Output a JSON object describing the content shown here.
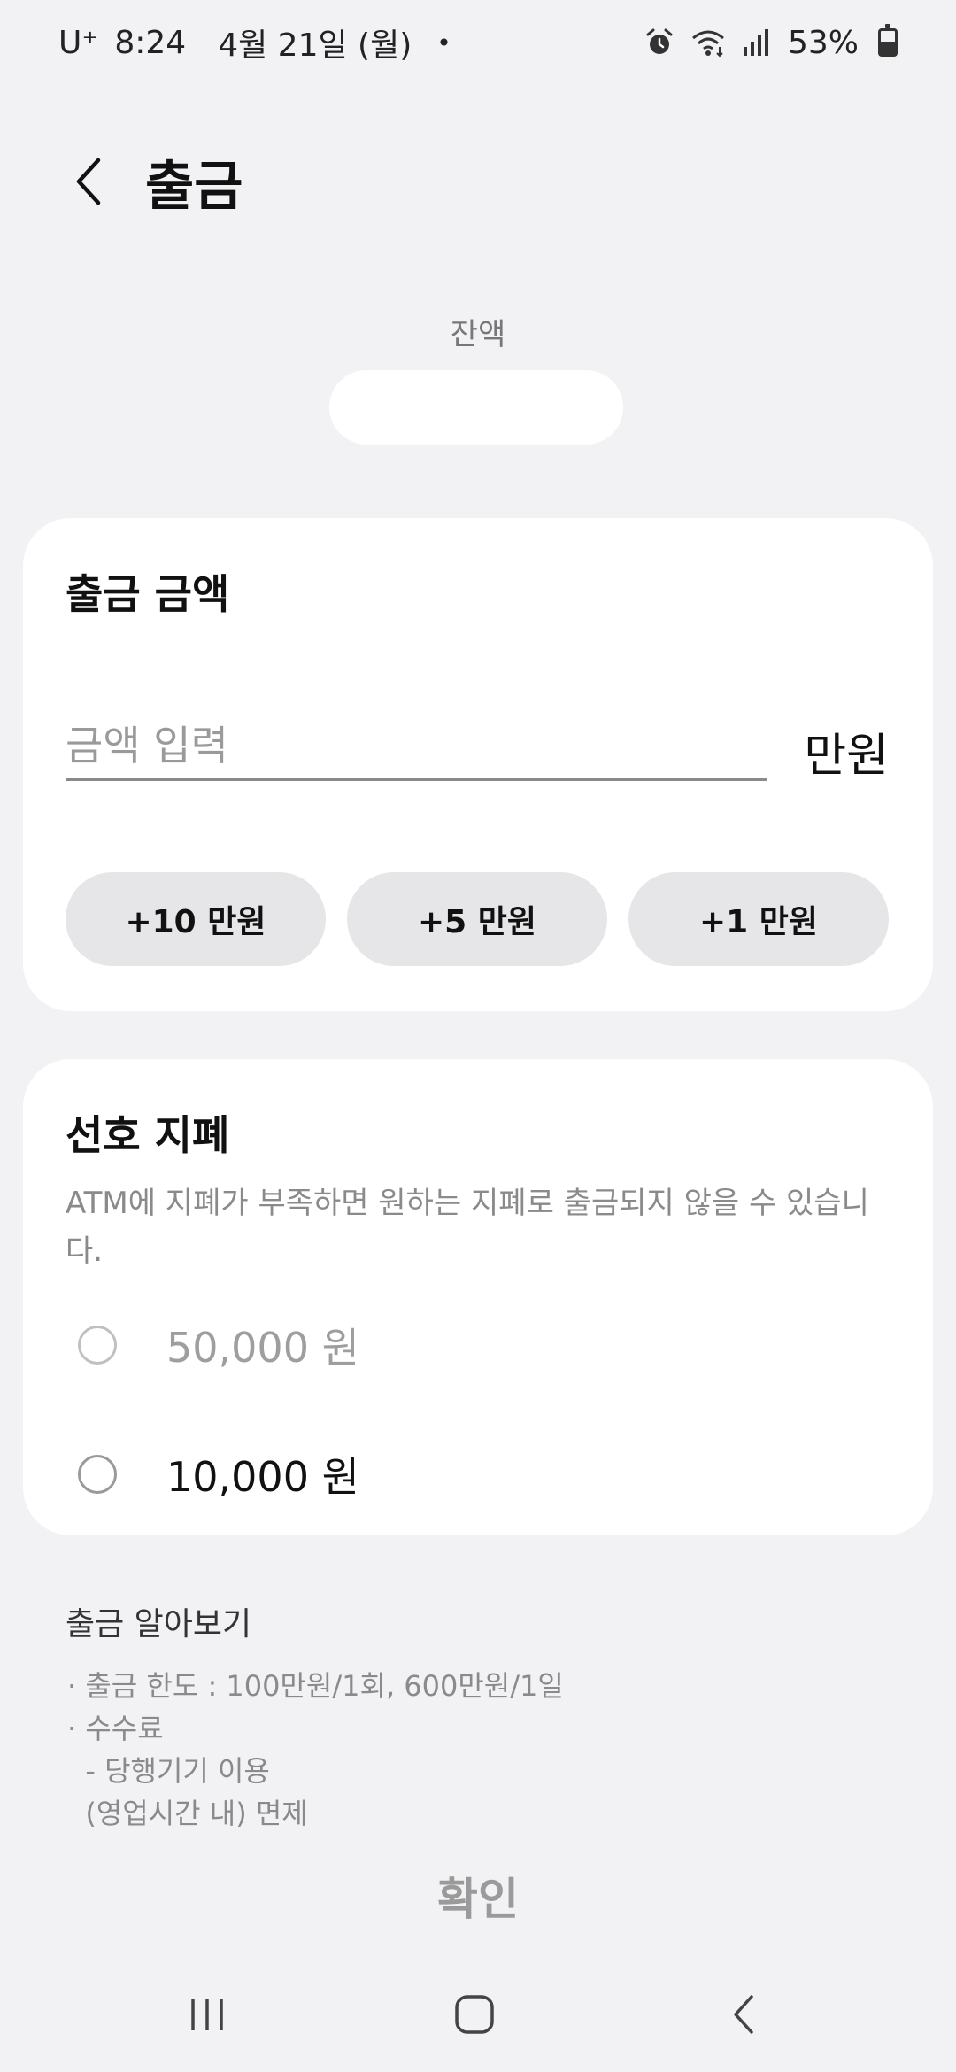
{
  "status_bar": {
    "carrier": "U⁺",
    "time": "8:24",
    "date": "4월 21일 (월)",
    "dot": "•",
    "battery": "53%",
    "battery_level": 0.53,
    "icons": [
      "alarm-icon",
      "wifi-icon",
      "signal-icon",
      "battery-icon"
    ]
  },
  "header": {
    "title": "출금",
    "back_icon": "chevron-left-icon"
  },
  "balance": {
    "label": "잔액",
    "value": ""
  },
  "amount_card": {
    "title": "출금 금액",
    "input_placeholder": "금액 입력",
    "input_value": "",
    "unit": "만원",
    "quick_buttons": [
      "+10 만원",
      "+5 만원",
      "+1 만원"
    ]
  },
  "notes_card": {
    "title": "선호 지폐",
    "description": "ATM에 지폐가 부족하면 원하는 지폐로 출금되지 않을 수 있습니다.",
    "options": [
      {
        "label": "50,000 원",
        "enabled": false,
        "selected": false
      },
      {
        "label": "10,000 원",
        "enabled": true,
        "selected": false
      }
    ]
  },
  "info": {
    "title": "출금 알아보기",
    "lines": [
      "· 출금 한도 : 100만원/1회, 600만원/1일",
      "· 수수료",
      "  - 당행기기 이용",
      "  (영업시간 내) 면제"
    ]
  },
  "confirm_label": "확인",
  "nav": [
    "recent-apps-icon",
    "home-icon",
    "back-icon"
  ],
  "colors": {
    "background": "#f2f2f4",
    "card": "#ffffff",
    "chip": "#e6e6e8",
    "muted_text": "#8a8a8a"
  }
}
